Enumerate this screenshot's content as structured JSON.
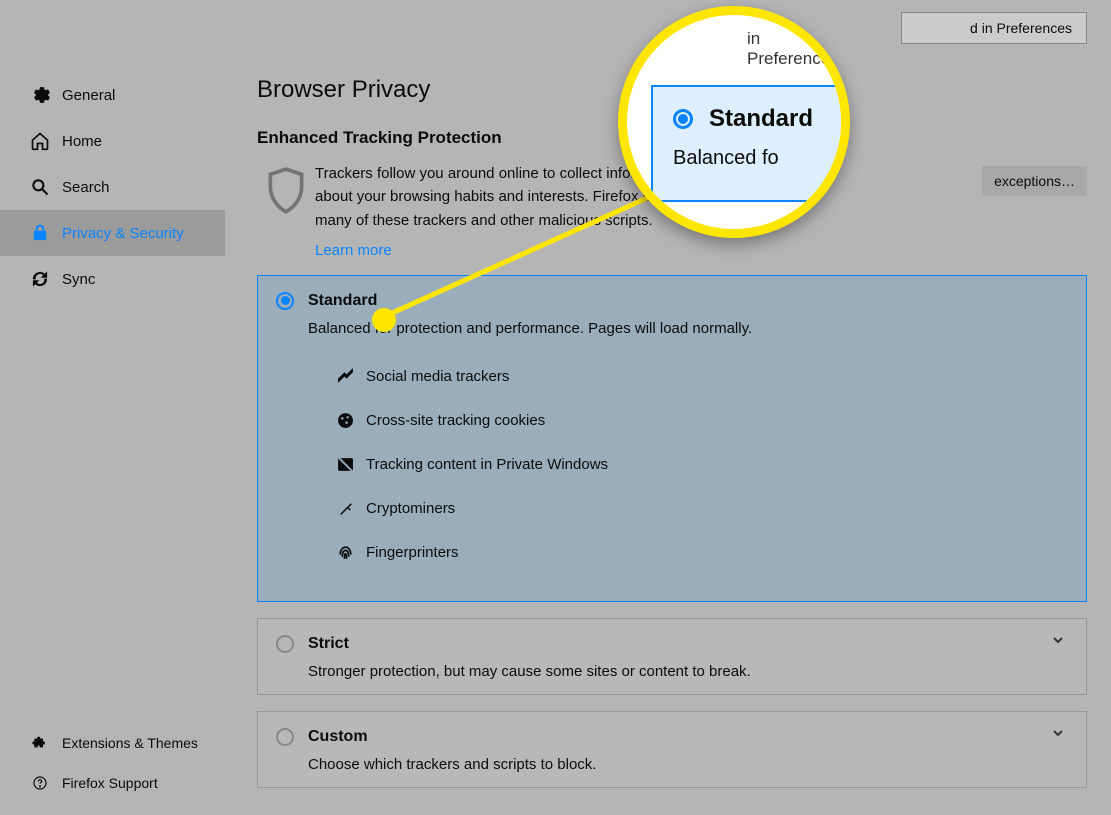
{
  "search": {
    "placeholder": "d in Preferences"
  },
  "sidebar": {
    "items": [
      {
        "label": "General"
      },
      {
        "label": "Home"
      },
      {
        "label": "Search"
      },
      {
        "label": "Privacy & Security"
      },
      {
        "label": "Sync"
      }
    ],
    "footer": [
      {
        "label": "Extensions & Themes"
      },
      {
        "label": "Firefox Support"
      }
    ]
  },
  "main": {
    "title": "Browser Privacy",
    "subhead": "Enhanced Tracking Protection",
    "intro_line1": "Trackers follow you around online to collect information",
    "intro_line2": "about your browsing habits and interests. Firefox blocks",
    "intro_line3": "many of these trackers and other malicious scripts.",
    "learn_more": "Learn more",
    "exceptions_button": "exceptions…"
  },
  "options": {
    "standard": {
      "title": "Standard",
      "desc": "Balanced for protection and performance. Pages will load normally.",
      "items": [
        "Social media trackers",
        "Cross-site tracking cookies",
        "Tracking content in Private Windows",
        "Cryptominers",
        "Fingerprinters"
      ]
    },
    "strict": {
      "title": "Strict",
      "desc": "Stronger protection, but may cause some sites or content to break."
    },
    "custom": {
      "title": "Custom",
      "desc": "Choose which trackers and scripts to block."
    }
  },
  "magnifier": {
    "title": "Standard",
    "desc": "Balanced fo",
    "pref": "in Preferences"
  }
}
